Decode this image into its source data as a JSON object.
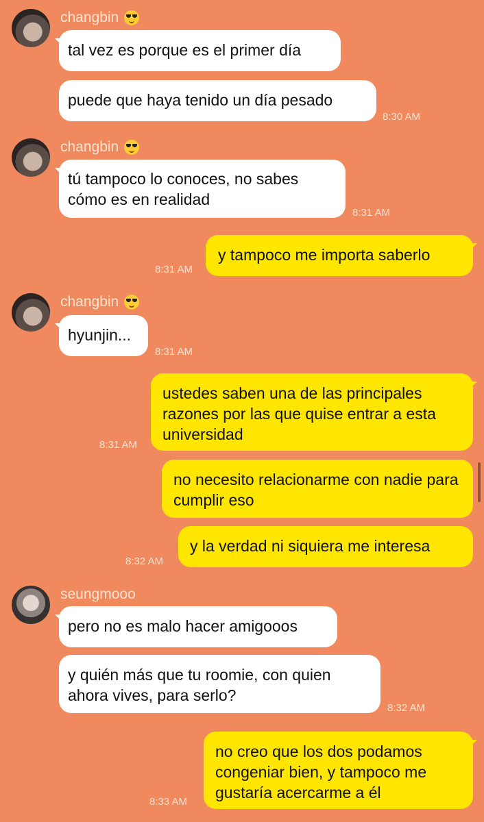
{
  "colors": {
    "background": "#F0895E",
    "incoming_bubble": "#FFFFFF",
    "outgoing_bubble": "#FFE600",
    "meta_text": "#FBE3D2"
  },
  "messages": [
    {
      "sender": "changbin",
      "sender_emoji": "😎",
      "text": "tal vez es porque es el primer día"
    },
    {
      "text": "puede que haya tenido un día pesado",
      "time": "8:30 AM"
    },
    {
      "sender": "changbin",
      "sender_emoji": "😎",
      "text": "tú tampoco lo conoces, no sabes cómo es en realidad",
      "time": "8:31 AM"
    },
    {
      "text": "y tampoco me importa saberlo",
      "time": "8:31 AM"
    },
    {
      "sender": "changbin",
      "sender_emoji": "😎",
      "text": "hyunjin...",
      "time": "8:31 AM"
    },
    {
      "text": "ustedes saben una de las principales razones por las que quise entrar a esta universidad",
      "time": "8:31 AM"
    },
    {
      "text": "no necesito relacionarme con nadie para cumplir eso"
    },
    {
      "text": "y la verdad ni siquiera me interesa",
      "time": "8:32 AM"
    },
    {
      "sender": "seungmooo",
      "text": "pero no es malo hacer amigooos"
    },
    {
      "text": "y quién más que tu roomie, con quien ahora vives, para serlo?",
      "time": "8:32 AM"
    },
    {
      "text": "no creo que los dos podamos congeniar bien, y tampoco me gustaría acercarme a él",
      "time": "8:33 AM"
    }
  ]
}
